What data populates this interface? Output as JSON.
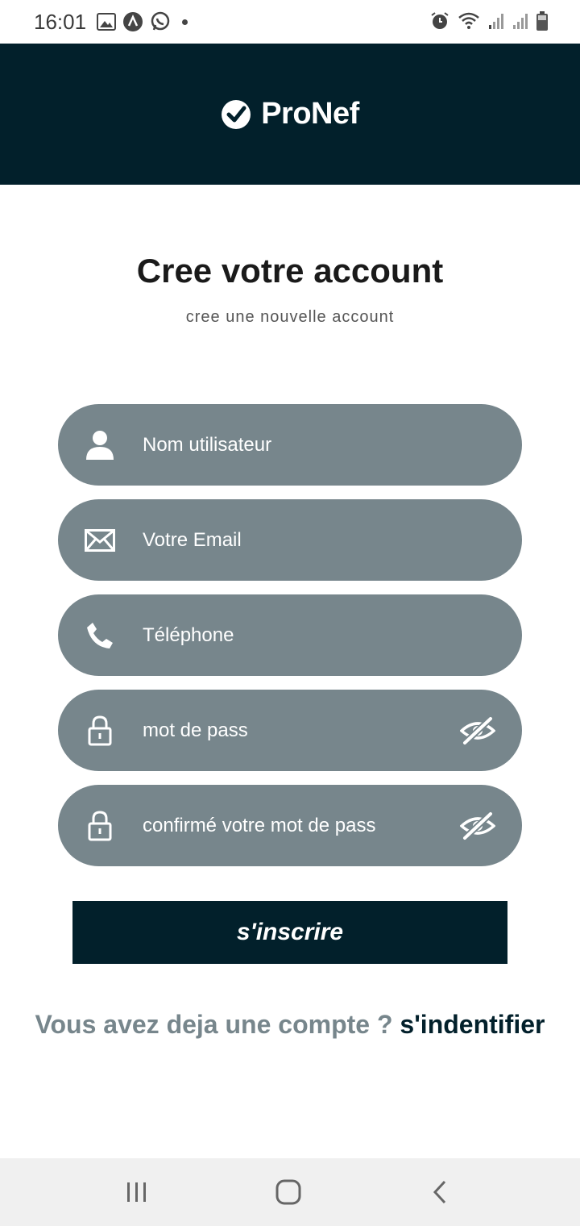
{
  "status_bar": {
    "time": "16:01",
    "left_icons": [
      "image-icon",
      "app-icon",
      "whatsapp-icon",
      "dot-icon"
    ],
    "right_icons": [
      "alarm-icon",
      "wifi-icon",
      "signal-icon",
      "signal-icon-2",
      "battery-icon"
    ]
  },
  "header": {
    "brand": "ProNef",
    "brand_icon": "check-circle-icon",
    "background": "#02202b"
  },
  "page": {
    "title": "Cree votre account",
    "subtitle": "cree une nouvelle account"
  },
  "form": {
    "fields": [
      {
        "label": "Nom utilisateur",
        "icon": "user-icon"
      },
      {
        "label": "Votre Email",
        "icon": "envelope-icon"
      },
      {
        "label": "Téléphone",
        "icon": "phone-icon"
      },
      {
        "label": "mot de pass",
        "icon": "lock-icon",
        "toggle_icon": "eye-off-icon"
      },
      {
        "label": "confirmé votre mot de pass",
        "icon": "lock-icon",
        "toggle_icon": "eye-off-icon"
      }
    ],
    "field_color": "#77868c",
    "submit_label": "s'inscrire"
  },
  "footer": {
    "question": "Vous avez deja une compte ?",
    "link": "s'indentifier"
  },
  "nav_bar": {
    "buttons": [
      "recent-apps-icon",
      "home-icon",
      "back-icon"
    ]
  }
}
